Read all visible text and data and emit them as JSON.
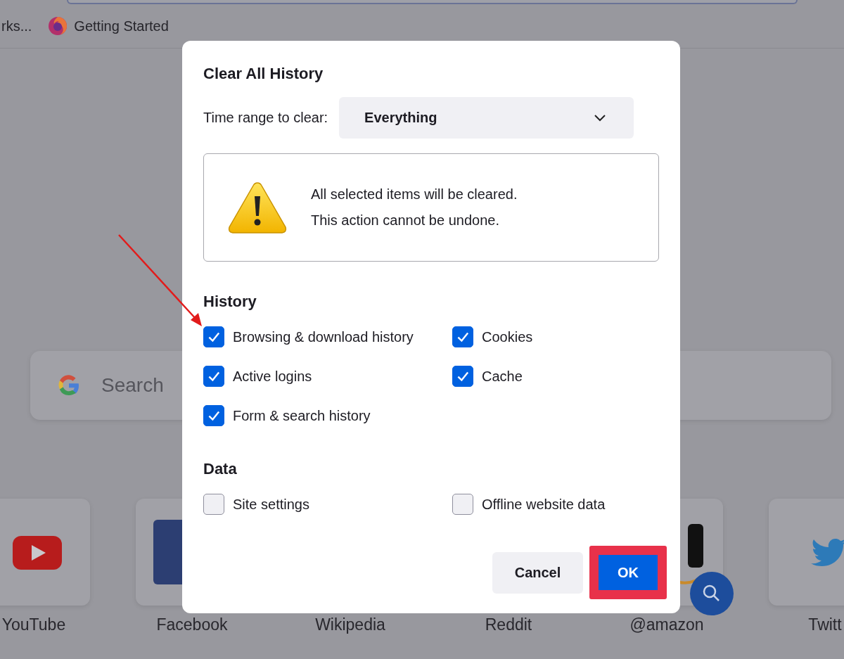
{
  "browser": {
    "bookmarks": [
      {
        "label": "rks...",
        "kind": "folder"
      },
      {
        "label": "Getting Started",
        "kind": "firefox"
      }
    ],
    "search": {
      "placeholder": "Search"
    },
    "shortcuts": [
      {
        "label": "YouTube",
        "kind": "youtube"
      },
      {
        "label": "Facebook",
        "kind": "facebook"
      },
      {
        "label": "Wikipedia",
        "kind": "hidden"
      },
      {
        "label": "Reddit",
        "kind": "hidden"
      },
      {
        "label": "@amazon",
        "kind": "amazon"
      },
      {
        "label": "Twitt",
        "kind": "twitter"
      }
    ]
  },
  "dialog": {
    "title": "Clear All History",
    "time_range": {
      "label": "Time range to clear:",
      "value": "Everything"
    },
    "warning": [
      "All selected items will be cleared.",
      "This action cannot be undone."
    ],
    "sections": [
      {
        "heading": "History",
        "items": [
          {
            "label": "Browsing & download history",
            "checked": true
          },
          {
            "label": "Cookies",
            "checked": true
          },
          {
            "label": "Active logins",
            "checked": true
          },
          {
            "label": "Cache",
            "checked": true
          },
          {
            "label": "Form & search history",
            "checked": true
          }
        ]
      },
      {
        "heading": "Data",
        "items": [
          {
            "label": "Site settings",
            "checked": false
          },
          {
            "label": "Offline website data",
            "checked": false
          }
        ]
      }
    ],
    "buttons": [
      {
        "label": "Cancel",
        "kind": "secondary",
        "highlighted": false
      },
      {
        "label": "OK",
        "kind": "primary",
        "highlighted": true
      }
    ]
  }
}
